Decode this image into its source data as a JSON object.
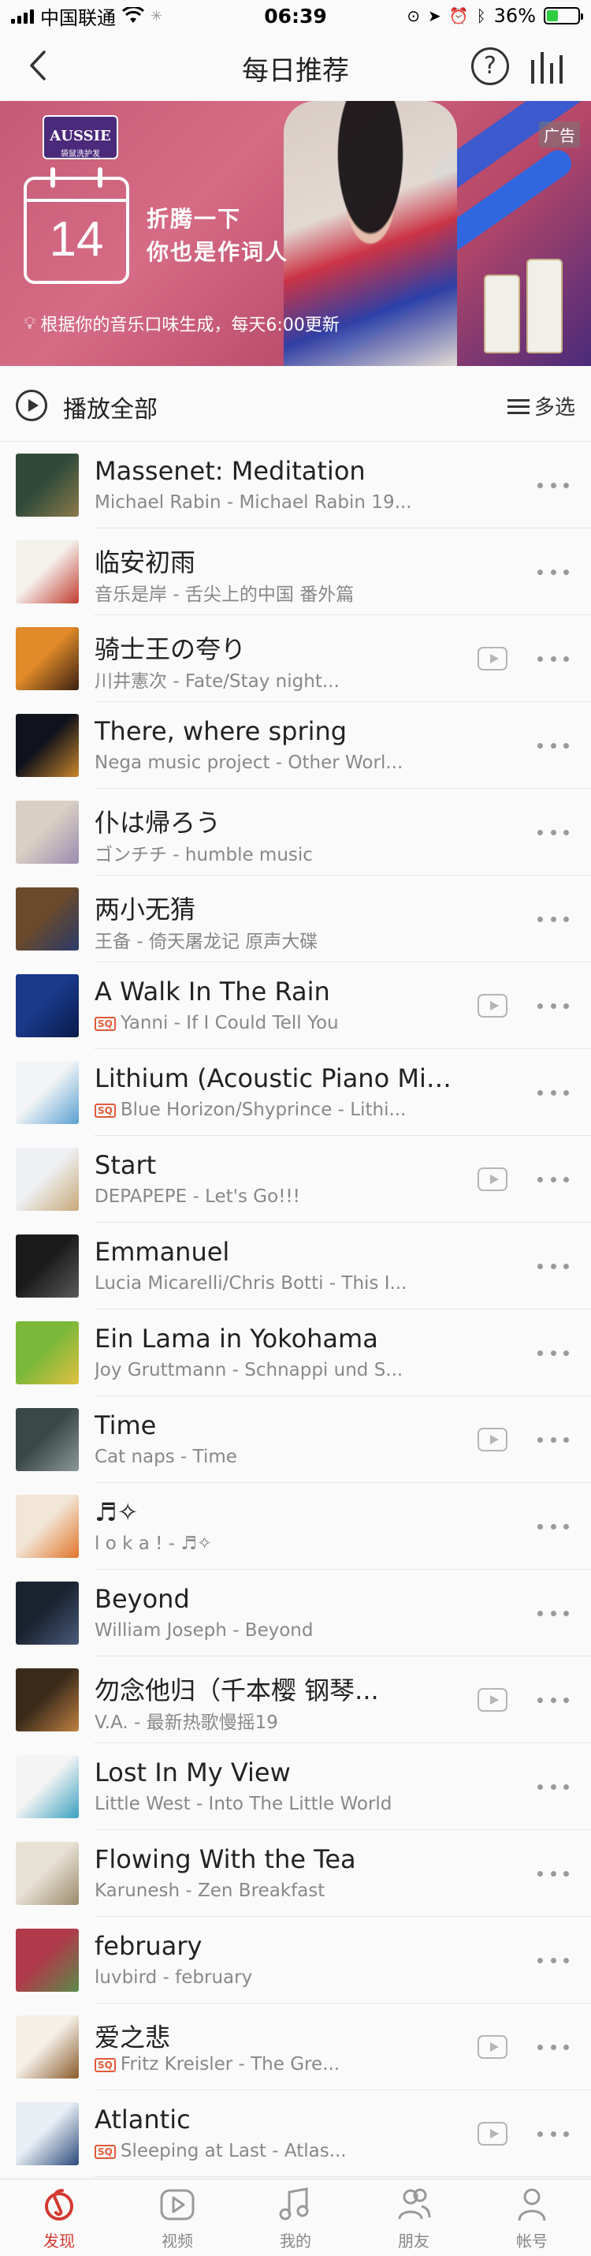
{
  "status_bar": {
    "carrier": "中国联通",
    "time": "06:39",
    "battery": "36%"
  },
  "nav": {
    "title": "每日推荐",
    "help_symbol": "?"
  },
  "banner": {
    "brand": "AUSSIE",
    "brand_sub": "袋鼠洗护发",
    "day": "14",
    "line1": "折腾一下",
    "line2": "你也是作词人",
    "subtitle": "根据你的音乐口味生成，每天6:00更新",
    "ad_label": "广告"
  },
  "play_all": {
    "label": "播放全部",
    "multi_select": "多选"
  },
  "songs": [
    {
      "title": "Massenet: Meditation",
      "subtitle": "Michael Rabin - Michael Rabin 19...",
      "sq": false,
      "mv": false,
      "cover": [
        "#2f4a3a",
        "#8b7a4a"
      ]
    },
    {
      "title": "临安初雨",
      "subtitle": "音乐是岸 - 舌尖上的中国 番外篇",
      "sq": false,
      "mv": false,
      "cover": [
        "#f4f1ec",
        "#c23b2f"
      ]
    },
    {
      "title": "骑士王の夸り",
      "subtitle": "川井憲次 - Fate/Stay night...",
      "sq": false,
      "mv": true,
      "cover": [
        "#e08a2a",
        "#3a2010"
      ]
    },
    {
      "title": "There, where spring",
      "subtitle": "Nega music project - Other Worl...",
      "sq": false,
      "mv": false,
      "cover": [
        "#10121c",
        "#c9862a"
      ]
    },
    {
      "title": "仆は帰ろう",
      "subtitle": "ゴンチチ - humble music",
      "sq": false,
      "mv": false,
      "cover": [
        "#d9cfc4",
        "#9a8bb0"
      ]
    },
    {
      "title": "两小无猜",
      "subtitle": "王备 - 倚天屠龙记 原声大碟",
      "sq": false,
      "mv": false,
      "cover": [
        "#6a4a2a",
        "#2a3a6a"
      ]
    },
    {
      "title": "A Walk In The Rain",
      "subtitle": "Yanni - If I Could Tell You",
      "sq": true,
      "mv": true,
      "cover": [
        "#1a3a8a",
        "#0a1a4a"
      ]
    },
    {
      "title": "Lithium (Acoustic Piano Mix)...",
      "subtitle": "Blue Horizon/Shyprince - Lithi...",
      "sq": true,
      "mv": false,
      "cover": [
        "#f2f4f6",
        "#5aa0d0"
      ]
    },
    {
      "title": "Start",
      "subtitle": "DEPAPEPE - Let's Go!!!",
      "sq": false,
      "mv": true,
      "cover": [
        "#eef0f4",
        "#c8a878"
      ]
    },
    {
      "title": "Emmanuel",
      "subtitle": "Lucia Micarelli/Chris Botti - This I...",
      "sq": false,
      "mv": false,
      "cover": [
        "#1a1a1a",
        "#5a5a5a"
      ]
    },
    {
      "title": "Ein Lama in Yokohama",
      "subtitle": "Joy Gruttmann - Schnappi und S...",
      "sq": false,
      "mv": false,
      "cover": [
        "#7ab83a",
        "#e0c040"
      ]
    },
    {
      "title": "Time",
      "subtitle": "Cat naps - Time",
      "sq": false,
      "mv": true,
      "cover": [
        "#3a4848",
        "#8a9898"
      ]
    },
    {
      "title": "♬✧",
      "subtitle": "l o k a ! - ♬✧",
      "sq": false,
      "mv": false,
      "cover": [
        "#f2e6d6",
        "#e0742a"
      ]
    },
    {
      "title": "Beyond",
      "subtitle": "William Joseph - Beyond",
      "sq": false,
      "mv": false,
      "cover": [
        "#1a2230",
        "#4a5a7a"
      ]
    },
    {
      "title": "勿念他归（千本樱 钢琴...",
      "subtitle": "V.A. - 最新热歌慢摇19",
      "sq": false,
      "mv": true,
      "cover": [
        "#3a2a1a",
        "#c08040"
      ]
    },
    {
      "title": "Lost In My View",
      "subtitle": "Little West - Into The Little World",
      "sq": false,
      "mv": false,
      "cover": [
        "#f4f4f4",
        "#3aa0c0"
      ]
    },
    {
      "title": "Flowing With the Tea",
      "subtitle": "Karunesh - Zen Breakfast",
      "sq": false,
      "mv": false,
      "cover": [
        "#e8e2d6",
        "#9a8a6a"
      ]
    },
    {
      "title": "february",
      "subtitle": "luvbird - february",
      "sq": false,
      "mv": false,
      "cover": [
        "#b03a4a",
        "#5a8a4a"
      ]
    },
    {
      "title": "爱之悲",
      "subtitle": "Fritz Kreisler - The Gre...",
      "sq": true,
      "mv": true,
      "cover": [
        "#f4f0e8",
        "#8a5a2a"
      ]
    },
    {
      "title": "Atlantic",
      "subtitle": "Sleeping at Last - Atlas...",
      "sq": true,
      "mv": true,
      "cover": [
        "#e8eef4",
        "#2a4a7a"
      ]
    }
  ],
  "sq_label": "SQ",
  "tabs": [
    {
      "label": "发现",
      "icon": "netease-music-icon",
      "active": true
    },
    {
      "label": "视频",
      "icon": "video-icon",
      "active": false
    },
    {
      "label": "我的",
      "icon": "music-note-icon",
      "active": false
    },
    {
      "label": "朋友",
      "icon": "friends-icon",
      "active": false
    },
    {
      "label": "帐号",
      "icon": "account-icon",
      "active": false
    }
  ],
  "colors": {
    "accent": "#d33a31",
    "sq_badge": "#e05a3a",
    "banner_bg": "#c45b76"
  }
}
